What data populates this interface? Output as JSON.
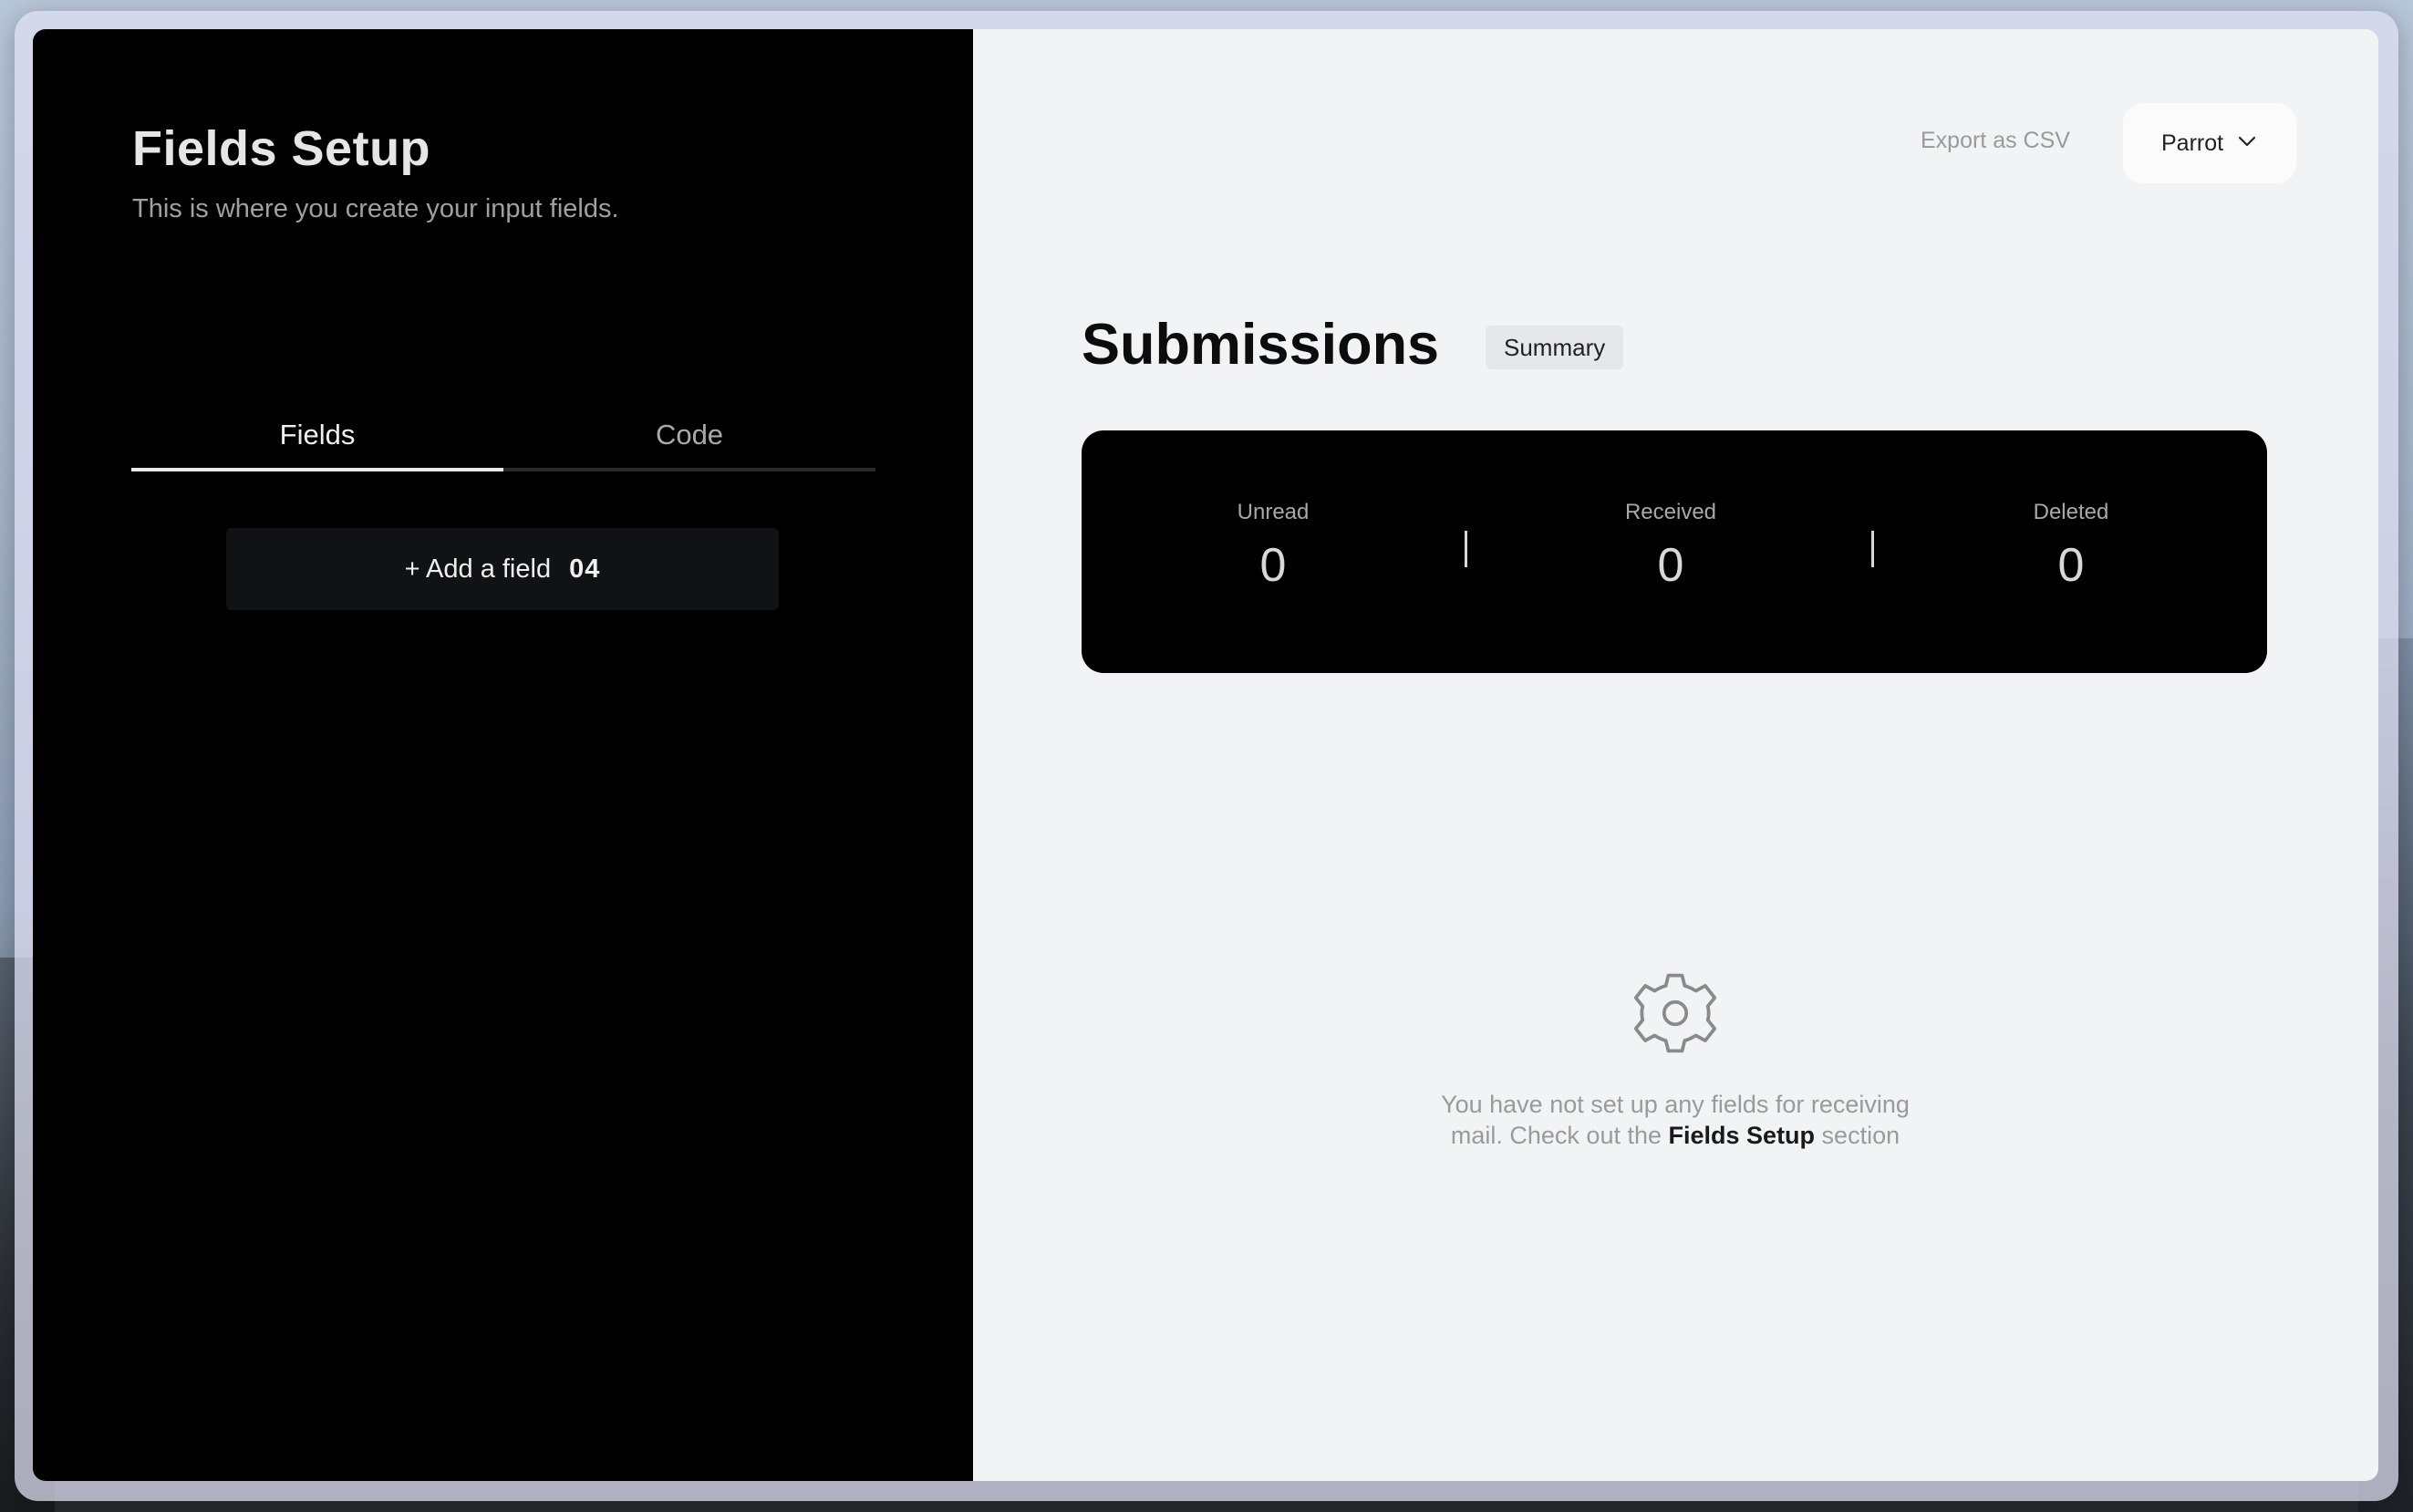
{
  "left_panel": {
    "title": "Fields Setup",
    "subtitle": "This is where you create your input fields.",
    "tabs": [
      {
        "label": "Fields",
        "active": true
      },
      {
        "label": "Code",
        "active": false
      }
    ],
    "add_field": {
      "label": "+ Add a field",
      "count": "04"
    }
  },
  "right_panel": {
    "export_label": "Export as CSV",
    "project_select": {
      "value": "Parrot",
      "icon": "chevron-down-icon"
    },
    "title": "Submissions",
    "badge": "Summary",
    "stats": [
      {
        "label": "Unread",
        "value": "0"
      },
      {
        "label": "Received",
        "value": "0"
      },
      {
        "label": "Deleted",
        "value": "0"
      }
    ],
    "empty_state": {
      "icon": "gear-icon",
      "text_before": "You have not set up any fields for receiving mail. Check out the ",
      "text_bold": "Fields Setup",
      "text_after": " section"
    }
  },
  "colors": {
    "left_background": "#000000",
    "right_background": "#f2f3f5",
    "card_background": "#000000"
  }
}
